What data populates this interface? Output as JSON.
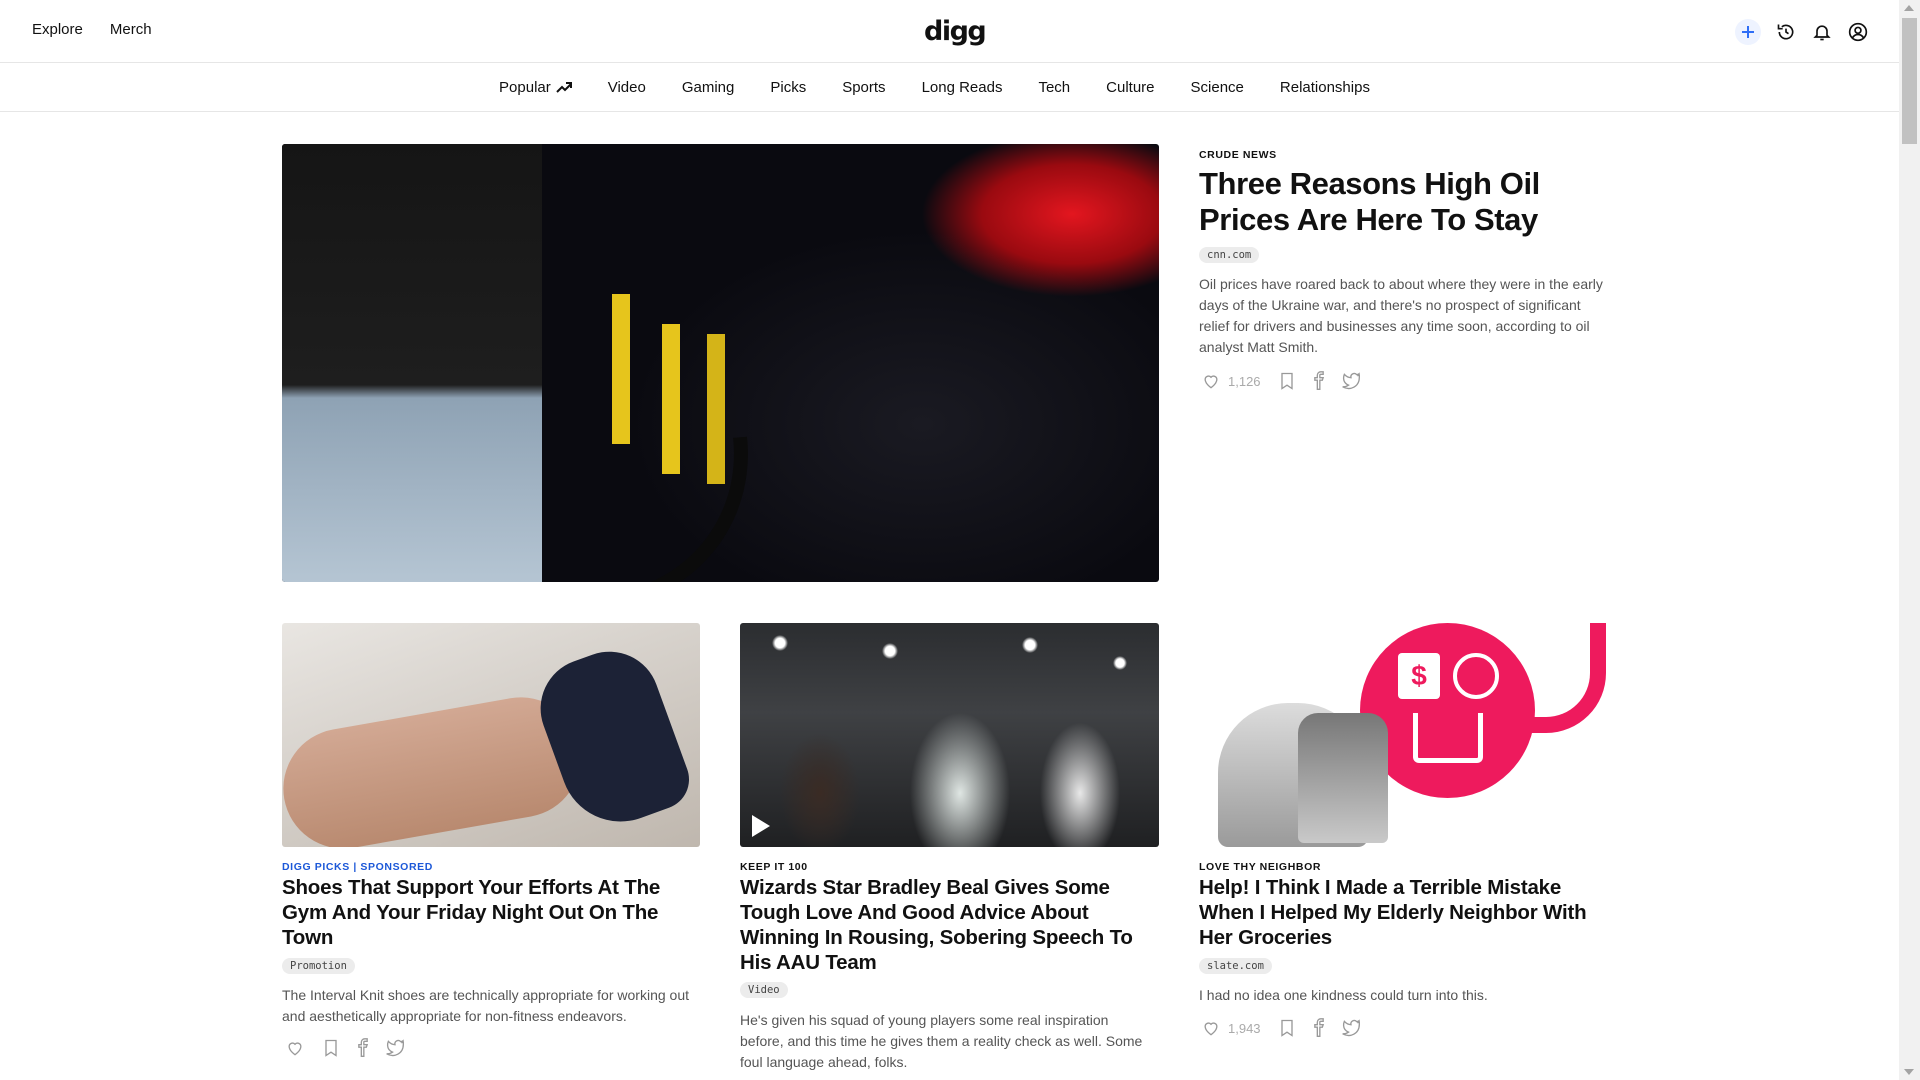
{
  "header": {
    "left_links": [
      "Explore",
      "Merch"
    ],
    "logo": "digg",
    "icons": [
      "plus-icon",
      "history-icon",
      "bell-icon",
      "user-icon"
    ]
  },
  "nav": {
    "items": [
      "Popular",
      "Video",
      "Gaming",
      "Picks",
      "Sports",
      "Long Reads",
      "Tech",
      "Culture",
      "Science",
      "Relationships"
    ],
    "popular_icon": "trending-icon"
  },
  "hero": {
    "kicker": "CRUDE NEWS",
    "title": "Three Reasons High Oil Prices Are Here To Stay",
    "source": "cnn.com",
    "description": "Oil prices have roared back to about where they were in the early days of the Ukraine war, and there's no prospect of significant relief for drivers and businesses any time soon, according to oil analyst Matt Smith.",
    "likes": "1,126",
    "image": "gas-pump-photo"
  },
  "cards": [
    {
      "kicker": "DIGG PICKS | SPONSORED",
      "title": "Shoes That Support Your Efforts At The Gym And Your Friday Night Out On The Town",
      "tag": "Promotion",
      "description": "The Interval Knit shoes are technically appropriate for working out and aesthetically appropriate for non-fitness endeavors.",
      "image": "sneaker-photo"
    },
    {
      "kicker": "KEEP IT 100",
      "title": "Wizards Star Bradley Beal Gives Some Tough Love And Good Advice About Winning In Rousing, Sobering Speech To His AAU Team",
      "tag": "Video",
      "description": "He's given his squad of young players some real inspiration before, and this time he gives them a reality check as well. Some foul language ahead, folks.",
      "image": "basketball-team-video-still"
    },
    {
      "kicker": "LOVE THY NEIGHBOR",
      "title": "Help! I Think I Made a Terrible Mistake When I Helped My Elderly Neighbor With Her Groceries",
      "tag": "slate.com",
      "description": "I had no idea one kindness could turn into this.",
      "likes": "1,943",
      "image": "grocery-neighbor-illustration"
    }
  ],
  "colors": {
    "accent_blue": "#1c58d8",
    "promo_pink": "#ee1a5d"
  }
}
